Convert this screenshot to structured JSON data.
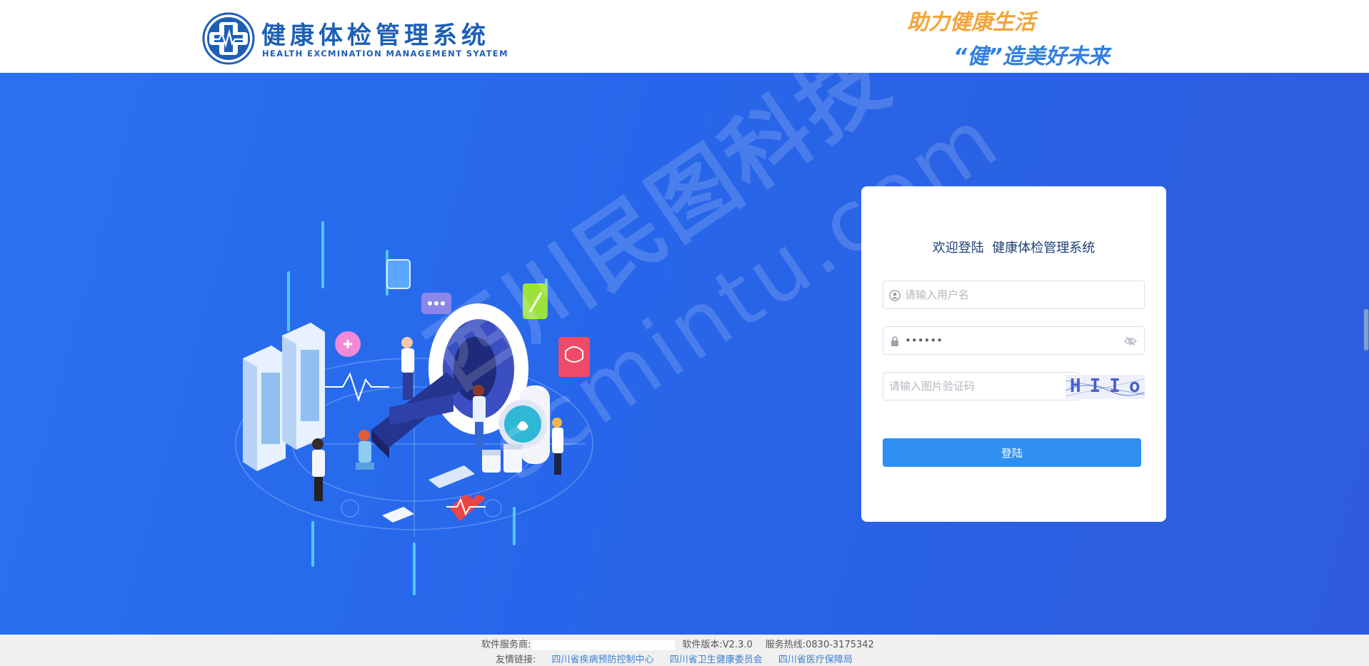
{
  "header": {
    "brand_cn": "健康体检管理系统",
    "brand_en": "HEALTH EXCMINATION MANAGEMENT SYATEM",
    "slogan_line1": "助力健康生活",
    "slogan_line2": "“健”造美好未来",
    "logo_icon": "medical-cross-logo"
  },
  "watermark": {
    "cn": "西川民图科技",
    "en": "scmintu.com"
  },
  "login": {
    "title": "欢迎登陆  健康体检管理系统",
    "username_placeholder": "请输入用户名",
    "username_value": "",
    "password_value": "123456",
    "captcha_placeholder": "请输入图片验证码",
    "captcha_text": "HIIo",
    "submit_label": "登陆",
    "user_icon": "user-icon",
    "lock_icon": "lock-icon",
    "eye_icon": "eye-off-icon"
  },
  "footer": {
    "provider_label": "软件服务商:",
    "version": "软件版本:V2.3.0",
    "hotline": "服务热线:0830-3175342",
    "links_label": "友情链接:",
    "links": [
      "四川省疾病预防控制中心",
      "四川省卫生健康委员会",
      "四川省医疗保障局"
    ]
  },
  "colors": {
    "accent": "#2e8ff0",
    "hero_bg": "#2a6cee",
    "brand": "#1d5fb5",
    "slogan_orange": "#f2a53a"
  }
}
